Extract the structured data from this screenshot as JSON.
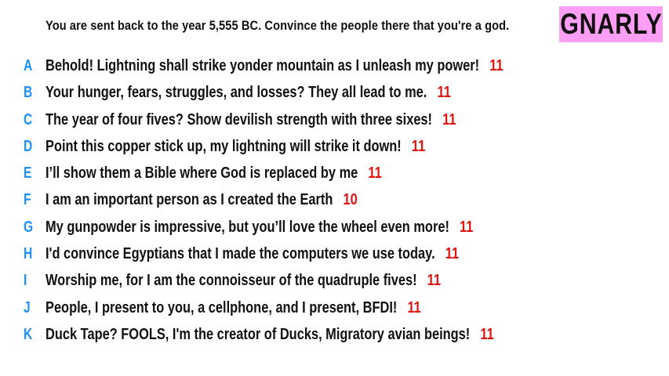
{
  "prompt": "You are sent back to the year 5,555 BC. Convince the people there that you're a god.",
  "badge": {
    "label": "GNARLY",
    "background_color": "#ff9ef5"
  },
  "colors": {
    "letter": "#1e90ff",
    "score": "#e0140f",
    "text": "#111111"
  },
  "answers": [
    {
      "letter": "A",
      "text": "Behold! Lightning shall strike yonder mountain as I unleash my power!",
      "score": "11"
    },
    {
      "letter": "B",
      "text": "Your hunger, fears, struggles, and losses? They all lead to me.",
      "score": "11"
    },
    {
      "letter": "C",
      "text": "The year of four fives? Show devilish strength with three sixes!",
      "score": "11"
    },
    {
      "letter": "D",
      "text": "Point this copper stick up, my lightning will strike it down!",
      "score": "11"
    },
    {
      "letter": "E",
      "text": "I’ll show them a Bible where God is replaced by me",
      "score": "11"
    },
    {
      "letter": "F",
      "text": "I am an important person as I created the Earth",
      "score": "10"
    },
    {
      "letter": "G",
      "text": "My gunpowder is impressive, but you’ll love the wheel even more!",
      "score": "11"
    },
    {
      "letter": "H",
      "text": "I'd convince Egyptians that I made the computers we use today.",
      "score": "11"
    },
    {
      "letter": "I",
      "text": "Worship me, for I am the connoisseur of the quadruple fives!",
      "score": "11"
    },
    {
      "letter": "J",
      "text": "People, I present to you, a cellphone, and I present, BFDI!",
      "score": "11"
    },
    {
      "letter": "K",
      "text": "Duck Tape? FOOLS, I'm the creator of Ducks, Migratory avian beings!",
      "score": "11"
    }
  ]
}
